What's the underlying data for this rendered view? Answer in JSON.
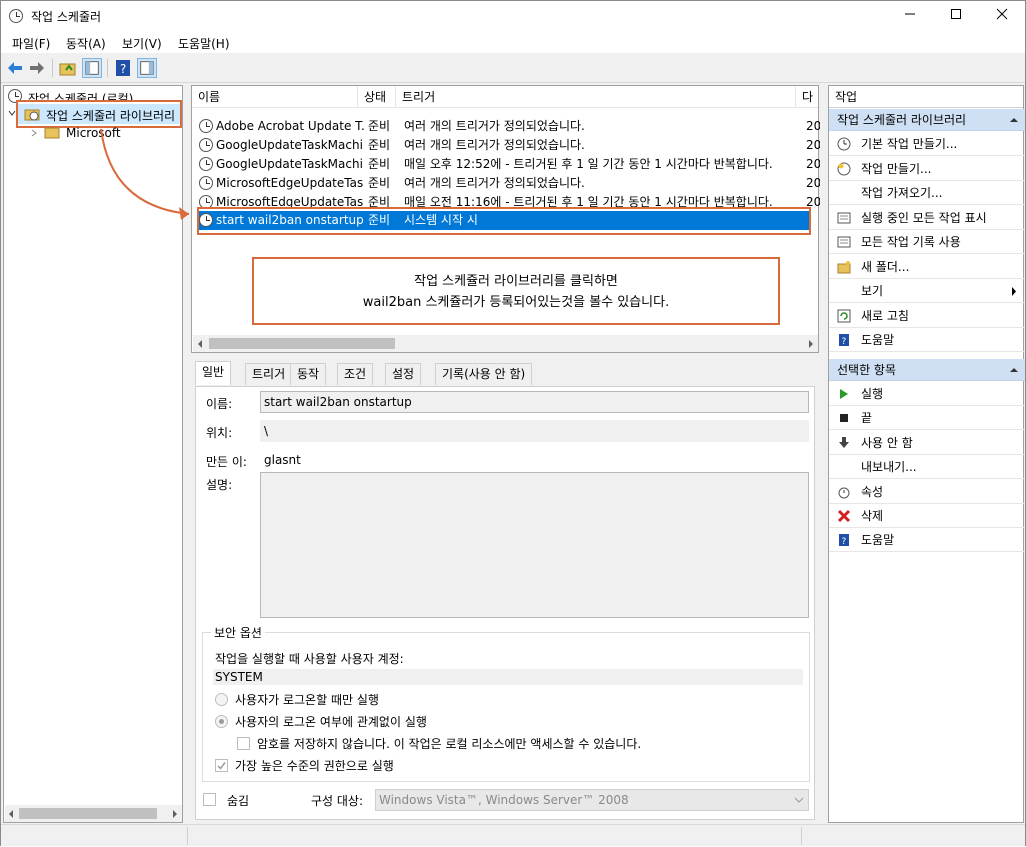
{
  "window": {
    "title": "작업 스케줄러"
  },
  "menu": [
    "파일(F)",
    "동작(A)",
    "보기(V)",
    "도움말(H)"
  ],
  "tree": {
    "root": "작업 스케줄러 (로컬)",
    "library": "작업 스케줄러 라이브러리",
    "child": "Microsoft"
  },
  "tasklist": {
    "headers": [
      "이름",
      "상태",
      "트리거",
      "다"
    ],
    "rows": [
      {
        "name": "Adobe Acrobat Update T...",
        "status": "준비",
        "trigger": "여러 개의 트리거가 정의되었습니다.",
        "next": "20"
      },
      {
        "name": "GoogleUpdateTaskMachi...",
        "status": "준비",
        "trigger": "여러 개의 트리거가 정의되었습니다.",
        "next": "20"
      },
      {
        "name": "GoogleUpdateTaskMachi...",
        "status": "준비",
        "trigger": "매일 오후 12:52에 - 트리거된 후 1 일 기간 동안 1 시간마다 반복합니다.",
        "next": "20"
      },
      {
        "name": "MicrosoftEdgeUpdateTas...",
        "status": "준비",
        "trigger": "여러 개의 트리거가 정의되었습니다.",
        "next": "20"
      },
      {
        "name": "MicrosoftEdgeUpdateTas...",
        "status": "준비",
        "trigger": "매일 오전 11:16에 - 트리거된 후 1 일 기간 동안 1 시간마다 반복합니다.",
        "next": "20"
      },
      {
        "name": "start wail2ban onstartup",
        "status": "준비",
        "trigger": "시스템 시작 시",
        "next": ""
      }
    ]
  },
  "annotation": {
    "line1": "작업 스케쥴러 라이브러리를 클릭하면",
    "line2": "wail2ban 스케쥴러가 등록되어있는것을 볼수 있습니다."
  },
  "tabs": [
    "일반",
    "트리거",
    "동작",
    "조건",
    "설정",
    "기록(사용 안 함)"
  ],
  "general": {
    "name_label": "이름:",
    "name_value": "start wail2ban onstartup",
    "location_label": "위치:",
    "location_value": "\\",
    "author_label": "만든 이:",
    "author_value": "glasnt",
    "desc_label": "설명:"
  },
  "security": {
    "group_title": "보안 옵션",
    "account_label": "작업을 실행할 때 사용할 사용자 계정:",
    "account_value": "SYSTEM",
    "radio1": "사용자가 로그온할 때만 실행",
    "radio2": "사용자의 로그온 여부에 관계없이 실행",
    "nopw": "암호를 저장하지 않습니다. 이 작업은 로컬 리소스에만 액세스할 수 있습니다.",
    "highest": "가장 높은 수준의 권한으로 실행"
  },
  "bottom": {
    "hidden": "숨김",
    "config_label": "구성 대상:",
    "config_value": "Windows Vista™, Windows Server™ 2008"
  },
  "actions": {
    "title": "작업",
    "section1": "작업 스케줄러 라이브러리",
    "items1": [
      "기본 작업 만들기...",
      "작업 만들기...",
      "작업 가져오기...",
      "실행 중인 모든 작업 표시",
      "모든 작업 기록 사용",
      "새 폴더...",
      "보기",
      "새로 고침",
      "도움말"
    ],
    "section2": "선택한 항목",
    "items2": [
      "실행",
      "끝",
      "사용 안 함",
      "내보내기...",
      "속성",
      "삭제",
      "도움말"
    ]
  }
}
